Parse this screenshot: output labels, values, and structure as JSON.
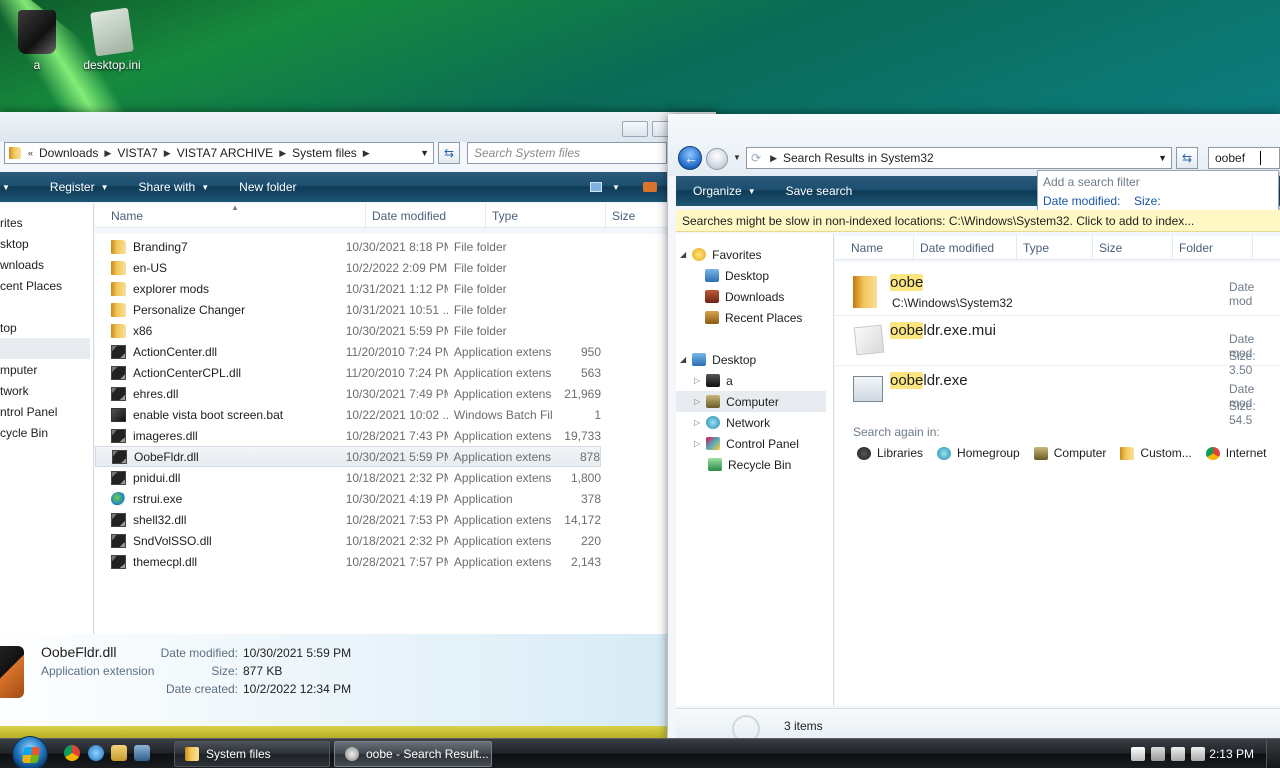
{
  "desktop": {
    "icons": [
      {
        "label": "a"
      },
      {
        "label": "desktop.ini"
      }
    ]
  },
  "left_window": {
    "breadcrumb": [
      "Downloads",
      "VISTA7",
      "VISTA7 ARCHIVE",
      "System files"
    ],
    "search_placeholder": "Search System files",
    "toolbar": {
      "register": "Register",
      "share_with": "Share with",
      "new_folder": "New folder"
    },
    "nav_items": [
      "rites",
      "sktop",
      "wnloads",
      "cent Places",
      "top",
      "",
      "mputer",
      "twork",
      "ntrol Panel",
      "cycle Bin"
    ],
    "columns": {
      "name": "Name",
      "date": "Date modified",
      "type": "Type",
      "size": "Size"
    },
    "files": [
      {
        "name": "Branding7",
        "date": "10/30/2021 8:18 PM",
        "type": "File folder",
        "size": "",
        "icon": "folder"
      },
      {
        "name": "en-US",
        "date": "10/2/2022 2:09 PM",
        "type": "File folder",
        "size": "",
        "icon": "folder"
      },
      {
        "name": "explorer mods",
        "date": "10/31/2021 1:12 PM",
        "type": "File folder",
        "size": "",
        "icon": "folder"
      },
      {
        "name": "Personalize Changer",
        "date": "10/31/2021 10:51 ...",
        "type": "File folder",
        "size": "",
        "icon": "folder"
      },
      {
        "name": "x86",
        "date": "10/30/2021 5:59 PM",
        "type": "File folder",
        "size": "",
        "icon": "folder"
      },
      {
        "name": "ActionCenter.dll",
        "date": "11/20/2010 7:24 PM",
        "type": "Application extens...",
        "size": "950",
        "icon": "dll"
      },
      {
        "name": "ActionCenterCPL.dll",
        "date": "11/20/2010 7:24 PM",
        "type": "Application extens...",
        "size": "563",
        "icon": "dll"
      },
      {
        "name": "ehres.dll",
        "date": "10/30/2021 7:49 PM",
        "type": "Application extens...",
        "size": "21,969",
        "icon": "dll"
      },
      {
        "name": "enable vista boot screen.bat",
        "date": "10/22/2021 10:02 ...",
        "type": "Windows Batch File",
        "size": "1",
        "icon": "bat"
      },
      {
        "name": "imageres.dll",
        "date": "10/28/2021 7:43 PM",
        "type": "Application extens...",
        "size": "19,733",
        "icon": "dll"
      },
      {
        "name": "OobeFldr.dll",
        "date": "10/30/2021 5:59 PM",
        "type": "Application extens...",
        "size": "878",
        "icon": "dll",
        "selected": true
      },
      {
        "name": "pnidui.dll",
        "date": "10/18/2021 2:32 PM",
        "type": "Application extens...",
        "size": "1,800",
        "icon": "dll"
      },
      {
        "name": "rstrui.exe",
        "date": "10/30/2021 4:19 PM",
        "type": "Application",
        "size": "378",
        "icon": "exe"
      },
      {
        "name": "shell32.dll",
        "date": "10/28/2021 7:53 PM",
        "type": "Application extens...",
        "size": "14,172",
        "icon": "dll"
      },
      {
        "name": "SndVolSSO.dll",
        "date": "10/18/2021 2:32 PM",
        "type": "Application extens...",
        "size": "220",
        "icon": "dll"
      },
      {
        "name": "themecpl.dll",
        "date": "10/28/2021 7:57 PM",
        "type": "Application extens...",
        "size": "2,143",
        "icon": "dll"
      }
    ],
    "details": {
      "name": "OobeFldr.dll",
      "kind": "Application extension",
      "date_modified_label": "Date modified:",
      "date_modified": "10/30/2021 5:59 PM",
      "size_label": "Size:",
      "size": "877 KB",
      "date_created_label": "Date created:",
      "date_created": "10/2/2022 12:34 PM"
    }
  },
  "right_window": {
    "address": "Search Results in System32",
    "search_value": "oobef",
    "search_filter": {
      "title": "Add a search filter",
      "date_modified": "Date modified:",
      "size": "Size:"
    },
    "toolbar": {
      "organize": "Organize",
      "save_search": "Save search"
    },
    "info_bar": "Searches might be slow in non-indexed locations: C:\\Windows\\System32. Click to add to index...",
    "nav": {
      "favorites": "Favorites",
      "favorites_items": [
        "Desktop",
        "Downloads",
        "Recent Places"
      ],
      "desktop": "Desktop",
      "desktop_items": [
        "a",
        "Computer",
        "Network",
        "Control Panel",
        "Recycle Bin"
      ]
    },
    "columns": {
      "name": "Name",
      "date": "Date modified",
      "type": "Type",
      "size": "Size",
      "folder": "Folder"
    },
    "results": [
      {
        "highlight": "oobe",
        "rest": "",
        "path": "C:\\Windows\\System32",
        "meta1": "Date mod",
        "meta2": ""
      },
      {
        "highlight": "oobe",
        "rest": "ldr.exe.mui",
        "path": "",
        "meta1": "Date mod",
        "meta2": "Size: 3.50"
      },
      {
        "highlight": "oobe",
        "rest": "ldr.exe",
        "path": "",
        "meta1": "Date mod",
        "meta2": "Size: 54.5"
      }
    ],
    "search_again_label": "Search again in:",
    "search_again": [
      "Libraries",
      "Homegroup",
      "Computer",
      "Custom...",
      "Internet"
    ],
    "status": "3 items"
  },
  "taskbar": {
    "buttons": [
      "System files",
      "oobe - Search Result..."
    ],
    "clock": "2:13 PM"
  }
}
